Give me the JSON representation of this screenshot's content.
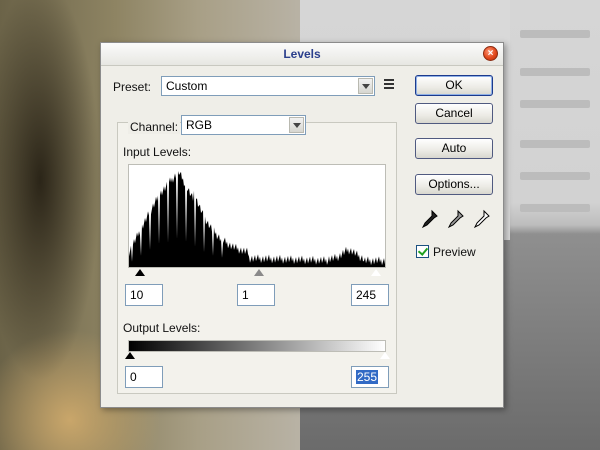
{
  "dialog": {
    "title": "Levels",
    "preset": {
      "label": "Preset:",
      "value": "Custom"
    },
    "channel": {
      "label": "Channel:",
      "value": "RGB"
    },
    "input_levels": {
      "label": "Input Levels:",
      "black": "10",
      "gamma": "1",
      "white": "245"
    },
    "output_levels": {
      "label": "Output Levels:",
      "black": "0",
      "white": "255"
    },
    "buttons": {
      "ok": "OK",
      "cancel": "Cancel",
      "auto": "Auto",
      "options": "Options..."
    },
    "preview": {
      "label": "Preview",
      "checked": true
    },
    "icons": [
      "close-icon",
      "preset-menu-icon",
      "black-eyedropper-icon",
      "gray-eyedropper-icon",
      "white-eyedropper-icon"
    ]
  }
}
